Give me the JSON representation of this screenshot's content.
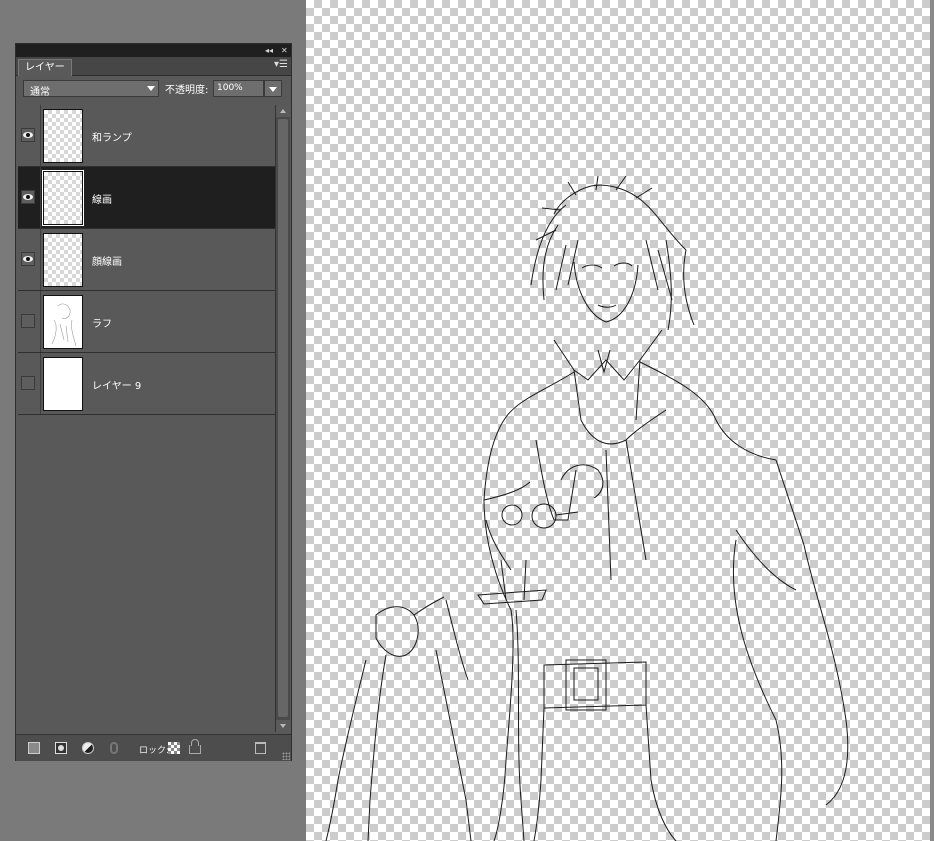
{
  "panel": {
    "title_controls": {
      "collapse": "◂◂",
      "close": "✕"
    },
    "tab_label": "レイヤー",
    "menu_icon": "panel-menu-icon",
    "blend_mode": "通常",
    "opacity_label": "不透明度:",
    "opacity_value": "100%",
    "layers": [
      {
        "name": "和ランプ",
        "visible": true,
        "selected": false,
        "thumbnail": "transparent"
      },
      {
        "name": "線画",
        "visible": true,
        "selected": true,
        "thumbnail": "transparent"
      },
      {
        "name": "顔線画",
        "visible": true,
        "selected": false,
        "thumbnail": "transparent"
      },
      {
        "name": "ラフ",
        "visible": false,
        "selected": false,
        "thumbnail": "sketch"
      },
      {
        "name": "レイヤー 9",
        "visible": false,
        "selected": false,
        "thumbnail": "white"
      }
    ],
    "bottom_bar": {
      "new_layer_icon": "new-layer-icon",
      "mask_icon": "layer-mask-icon",
      "adjustment_icon": "adjustment-layer-icon",
      "link_icon": "link-icon",
      "lock_label": "ロック:",
      "lock_transparent_icon": "lock-transparent-icon",
      "lock_all_icon": "lock-all-icon",
      "delete_icon": "trash-icon"
    }
  },
  "canvas": {
    "background": "transparent-checkerboard",
    "content": "line-art"
  },
  "colors": {
    "workspace": "#7a7a7a",
    "panel": "#595959",
    "selected_row": "#1f1f1f"
  }
}
